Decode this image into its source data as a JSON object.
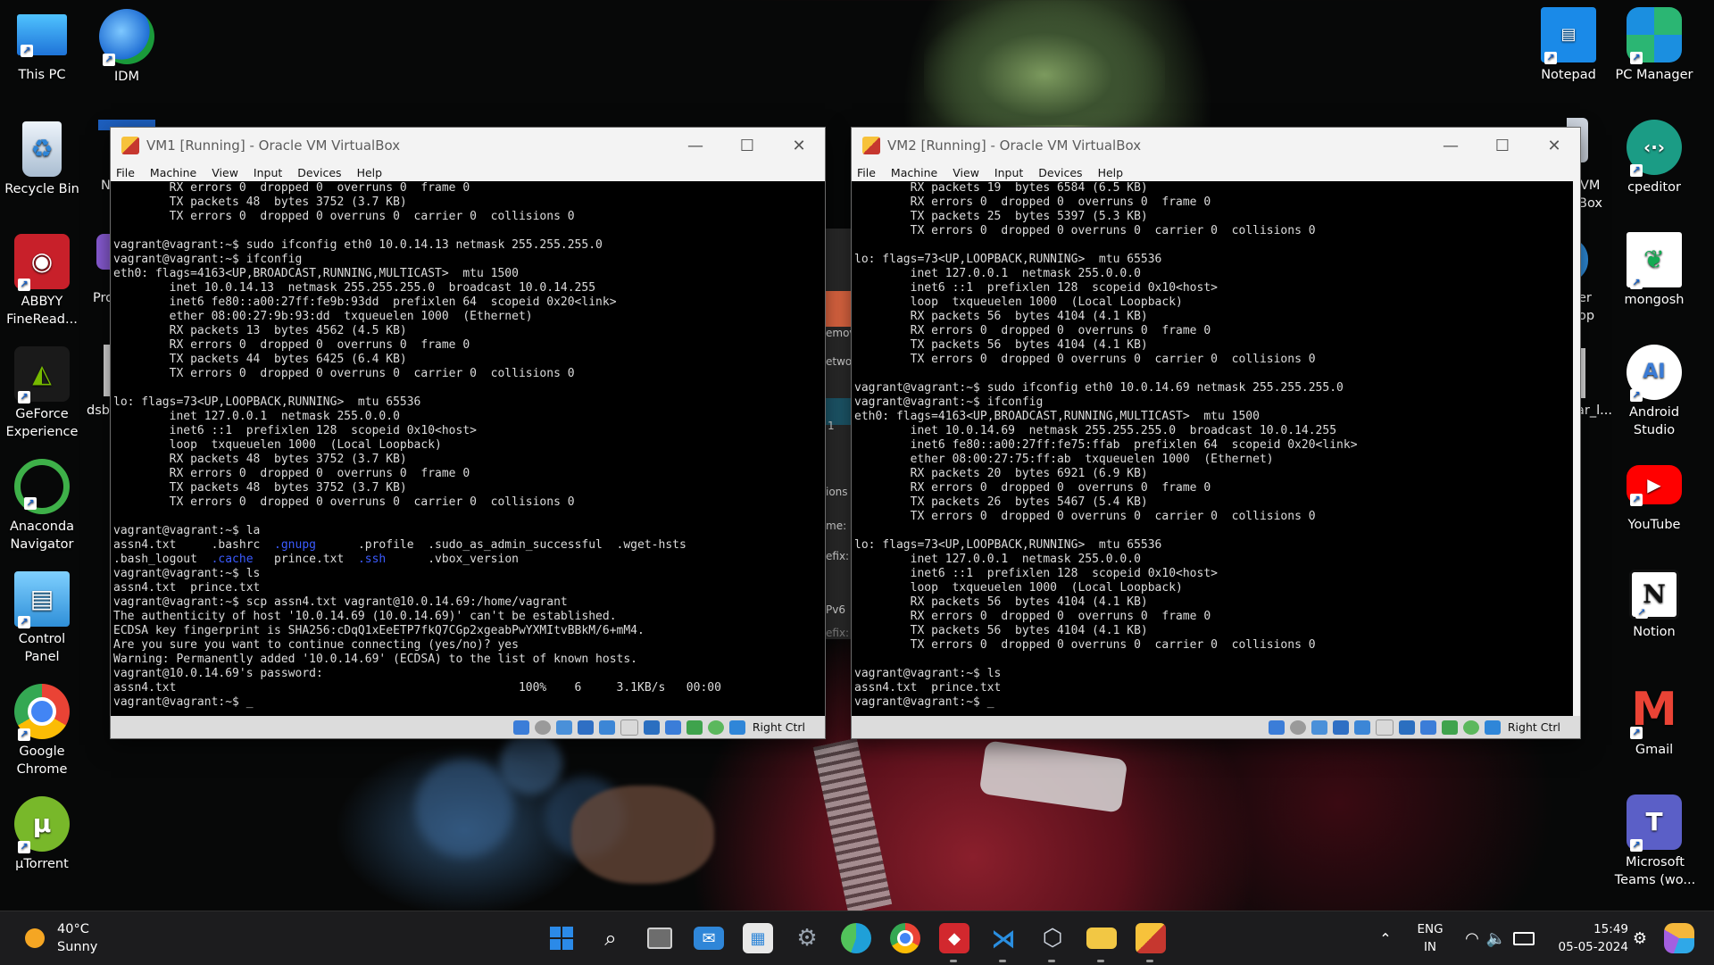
{
  "desktop": {
    "left_icons": [
      {
        "label": "This PC",
        "icon": "this-pc-icon",
        "color": "#1e90ff"
      },
      {
        "label": "Recycle Bin",
        "icon": "recycle-bin-icon",
        "color": "#9fb3c8"
      },
      {
        "label": "ABBYY FineRead...",
        "icon": "abbyy-icon",
        "color": "#c8202a"
      },
      {
        "label": "GeForce Experience",
        "icon": "geforce-icon",
        "color": "#76b900"
      },
      {
        "label": "Anaconda Navigator",
        "icon": "anaconda-icon",
        "color": "#3eb049"
      },
      {
        "label": "Control Panel",
        "icon": "control-panel-icon",
        "color": "#2f8fd8"
      },
      {
        "label": "Google Chrome",
        "icon": "chrome-icon",
        "color": "#4285f4"
      },
      {
        "label": "µTorrent",
        "icon": "utorrent-icon",
        "color": "#78b82a"
      }
    ],
    "second_col_icons": [
      {
        "label": "IDM",
        "icon": "idm-icon",
        "color": "#2a7de1"
      },
      {
        "label": "N",
        "icon": "partial-icon",
        "color": "#1d5fbf"
      },
      {
        "label": "Pro",
        "icon": "partial-icon",
        "color": "#8a5cd6"
      },
      {
        "label": "dsb",
        "icon": "partial-icon",
        "color": "#dddddd"
      }
    ],
    "right_icons": [
      {
        "label": "Notepad",
        "icon": "notepad-icon",
        "color": "#1a8ae8"
      },
      {
        "label": "PC Manager",
        "icon": "pc-manager-icon",
        "color": "#2bb673"
      },
      {
        "label": "cpeditor",
        "icon": "cpeditor-icon",
        "color": "#1b9c85"
      },
      {
        "label": "mongosh",
        "icon": "mongosh-icon",
        "color": "#13aa52"
      },
      {
        "label": "Android Studio",
        "icon": "android-studio-icon",
        "color": "#3a7bd5"
      },
      {
        "label": "YouTube",
        "icon": "youtube-icon",
        "color": "#ff0000"
      },
      {
        "label": "Notion",
        "icon": "notion-icon",
        "color": "#ffffff"
      },
      {
        "label": "Gmail",
        "icon": "gmail-icon",
        "color": "#ea4335"
      },
      {
        "label": "Microsoft Teams (wo...",
        "icon": "teams-icon",
        "color": "#5b5fc7"
      }
    ],
    "partial_right_labels": {
      "vm": "VM",
      "box": "Box",
      "er": "er",
      "op": "op",
      "ar": "ar_l..."
    },
    "behind_window_text": {
      "emov": "emov",
      "etwor": "etwor",
      "one": "1",
      "ions": "ions",
      "me": "me:",
      "efix": "efix:",
      "pv6": "Pv6",
      "efix2": "efix:"
    }
  },
  "vm1": {
    "title": "VM1 [Running] - Oracle VM VirtualBox",
    "menu": [
      "File",
      "Machine",
      "View",
      "Input",
      "Devices",
      "Help"
    ],
    "lines": [
      "        RX errors 0  dropped 0  overruns 0  frame 0",
      "        TX packets 48  bytes 3752 (3.7 KB)",
      "        TX errors 0  dropped 0 overruns 0  carrier 0  collisions 0",
      "",
      "vagrant@vagrant:~$ sudo ifconfig eth0 10.0.14.13 netmask 255.255.255.0",
      "vagrant@vagrant:~$ ifconfig",
      "eth0: flags=4163<UP,BROADCAST,RUNNING,MULTICAST>  mtu 1500",
      "        inet 10.0.14.13  netmask 255.255.255.0  broadcast 10.0.14.255",
      "        inet6 fe80::a00:27ff:fe9b:93dd  prefixlen 64  scopeid 0x20<link>",
      "        ether 08:00:27:9b:93:dd  txqueuelen 1000  (Ethernet)",
      "        RX packets 13  bytes 4562 (4.5 KB)",
      "        RX errors 0  dropped 0  overruns 0  frame 0",
      "        TX packets 44  bytes 6425 (6.4 KB)",
      "        TX errors 0  dropped 0 overruns 0  carrier 0  collisions 0",
      "",
      "lo: flags=73<UP,LOOPBACK,RUNNING>  mtu 65536",
      "        inet 127.0.0.1  netmask 255.0.0.0",
      "        inet6 ::1  prefixlen 128  scopeid 0x10<host>",
      "        loop  txqueuelen 1000  (Local Loopback)",
      "        RX packets 48  bytes 3752 (3.7 KB)",
      "        RX errors 0  dropped 0  overruns 0  frame 0",
      "        TX packets 48  bytes 3752 (3.7 KB)",
      "        TX errors 0  dropped 0 overruns 0  carrier 0  collisions 0",
      "",
      "vagrant@vagrant:~$ la",
      "assn4.txt     .bashrc  .gnupg      .profile  .sudo_as_admin_successful  .wget-hsts",
      ".bash_logout  .cache   prince.txt  .ssh      .vbox_version",
      "vagrant@vagrant:~$ ls",
      "assn4.txt  prince.txt",
      "vagrant@vagrant:~$ scp assn4.txt vagrant@10.0.14.69:/home/vagrant",
      "The authenticity of host '10.0.14.69 (10.0.14.69)' can't be established.",
      "ECDSA key fingerprint is SHA256:cDqQ1xEeETP7fkQ7CGp2xgeabPwYXMItvBBkM/6+mM4.",
      "Are you sure you want to continue connecting (yes/no)? yes",
      "Warning: Permanently added '10.0.14.69' (ECDSA) to the list of known hosts.",
      "vagrant@10.0.14.69's password:",
      "assn4.txt                                                 100%    6     3.1KB/s   00:00",
      "vagrant@vagrant:~$ _"
    ],
    "status_label": "Right Ctrl"
  },
  "vm2": {
    "title": "VM2 [Running] - Oracle VM VirtualBox",
    "menu": [
      "File",
      "Machine",
      "View",
      "Input",
      "Devices",
      "Help"
    ],
    "lines": [
      "        RX packets 19  bytes 6584 (6.5 KB)",
      "        RX errors 0  dropped 0  overruns 0  frame 0",
      "        TX packets 25  bytes 5397 (5.3 KB)",
      "        TX errors 0  dropped 0 overruns 0  carrier 0  collisions 0",
      "",
      "lo: flags=73<UP,LOOPBACK,RUNNING>  mtu 65536",
      "        inet 127.0.0.1  netmask 255.0.0.0",
      "        inet6 ::1  prefixlen 128  scopeid 0x10<host>",
      "        loop  txqueuelen 1000  (Local Loopback)",
      "        RX packets 56  bytes 4104 (4.1 KB)",
      "        RX errors 0  dropped 0  overruns 0  frame 0",
      "        TX packets 56  bytes 4104 (4.1 KB)",
      "        TX errors 0  dropped 0 overruns 0  carrier 0  collisions 0",
      "",
      "vagrant@vagrant:~$ sudo ifconfig eth0 10.0.14.69 netmask 255.255.255.0",
      "vagrant@vagrant:~$ ifconfig",
      "eth0: flags=4163<UP,BROADCAST,RUNNING,MULTICAST>  mtu 1500",
      "        inet 10.0.14.69  netmask 255.255.255.0  broadcast 10.0.14.255",
      "        inet6 fe80::a00:27ff:fe75:ffab  prefixlen 64  scopeid 0x20<link>",
      "        ether 08:00:27:75:ff:ab  txqueuelen 1000  (Ethernet)",
      "        RX packets 20  bytes 6921 (6.9 KB)",
      "        RX errors 0  dropped 0  overruns 0  frame 0",
      "        TX packets 26  bytes 5467 (5.4 KB)",
      "        TX errors 0  dropped 0 overruns 0  carrier 0  collisions 0",
      "",
      "lo: flags=73<UP,LOOPBACK,RUNNING>  mtu 65536",
      "        inet 127.0.0.1  netmask 255.0.0.0",
      "        inet6 ::1  prefixlen 128  scopeid 0x10<host>",
      "        loop  txqueuelen 1000  (Local Loopback)",
      "        RX packets 56  bytes 4104 (4.1 KB)",
      "        RX errors 0  dropped 0  overruns 0  frame 0",
      "        TX packets 56  bytes 4104 (4.1 KB)",
      "        TX errors 0  dropped 0 overruns 0  carrier 0  collisions 0",
      "",
      "vagrant@vagrant:~$ ls",
      "assn4.txt  prince.txt",
      "vagrant@vagrant:~$ _"
    ],
    "status_label": "Right Ctrl"
  },
  "taskbar": {
    "weather": {
      "temp": "40°C",
      "condition": "Sunny"
    },
    "apps": [
      {
        "name": "start-button",
        "color": "#2b8ae8"
      },
      {
        "name": "search-icon",
        "color": "#ffffff"
      },
      {
        "name": "task-view-icon",
        "color": "#cfcfcf"
      },
      {
        "name": "mail-icon",
        "color": "#2f86d8"
      },
      {
        "name": "store-icon",
        "color": "#e8e8e8"
      },
      {
        "name": "settings-icon",
        "color": "#9aa4b0"
      },
      {
        "name": "edge-icon",
        "color": "#1fa0d8"
      },
      {
        "name": "chrome-icon",
        "color": "#e33e2b"
      },
      {
        "name": "anydesk-icon",
        "color": "#d2282e"
      },
      {
        "name": "vscode-icon",
        "color": "#2a8ee0"
      },
      {
        "name": "virtualbox-icon",
        "color": "#cfd6e0"
      },
      {
        "name": "file-explorer-icon",
        "color": "#f2c744"
      },
      {
        "name": "virtualbox-vm-icon",
        "color": "#f7c23b"
      }
    ],
    "language": {
      "line1": "ENG",
      "line2": "IN"
    },
    "time": "15:49",
    "date": "05-05-2024"
  }
}
